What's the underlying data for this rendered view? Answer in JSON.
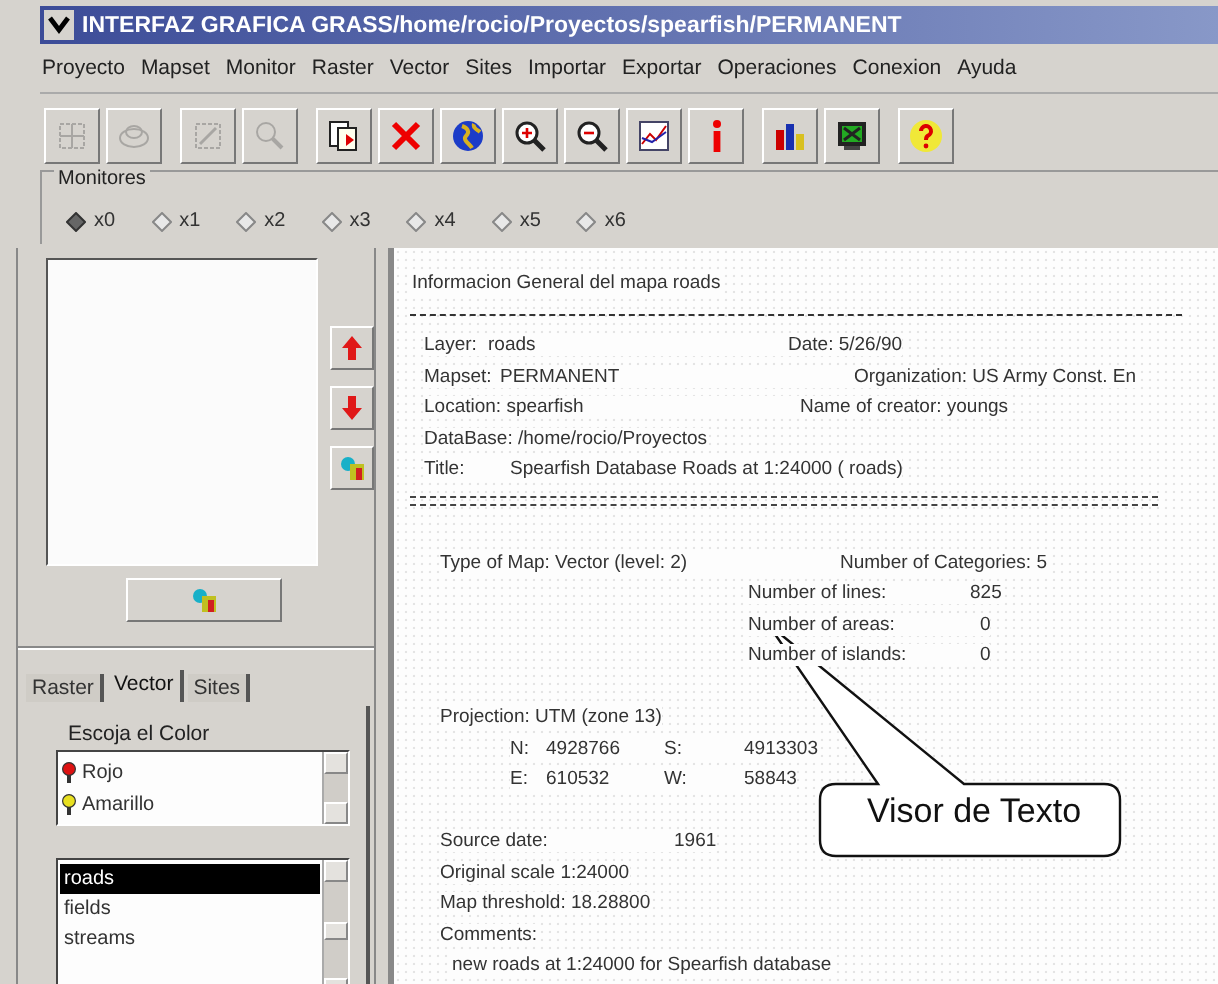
{
  "window": {
    "title": "INTERFAZ GRAFICA GRASS/home/rocio/Proyectos/spearfish/PERMANENT"
  },
  "menu": [
    "Proyecto",
    "Mapset",
    "Monitor",
    "Raster",
    "Vector",
    "Sites",
    "Importar",
    "Exportar",
    "Operaciones",
    "Conexion",
    "Ayuda"
  ],
  "toolbar": {
    "groups": [
      [
        {
          "disabled": true
        },
        {
          "disabled": true
        }
      ],
      [
        {
          "disabled": true
        },
        {
          "disabled": true
        }
      ],
      [
        {
          "disabled": false
        },
        {
          "disabled": false
        },
        {
          "disabled": false
        },
        {
          "disabled": false
        },
        {
          "disabled": false
        },
        {
          "disabled": false
        },
        {
          "disabled": false
        }
      ],
      [
        {
          "disabled": false
        },
        {
          "disabled": false
        }
      ],
      [
        {
          "disabled": false
        }
      ]
    ]
  },
  "monitors": {
    "label": "Monitores",
    "options": [
      {
        "label": "x0",
        "selected": true
      },
      {
        "label": "x1",
        "selected": false
      },
      {
        "label": "x2",
        "selected": false
      },
      {
        "label": "x3",
        "selected": false
      },
      {
        "label": "x4",
        "selected": false
      },
      {
        "label": "x5",
        "selected": false
      },
      {
        "label": "x6",
        "selected": false
      }
    ]
  },
  "layer_panel": {
    "tabs": [
      {
        "label": "Raster",
        "selected": false
      },
      {
        "label": "Vector",
        "selected": true
      },
      {
        "label": "Sites",
        "selected": false
      }
    ],
    "color_label": "Escoja el Color",
    "colors": [
      {
        "label": "Rojo",
        "color": "#dd1111"
      },
      {
        "label": "Amarillo",
        "color": "#e8e020"
      }
    ],
    "layers": [
      {
        "label": "roads",
        "selected": true
      },
      {
        "label": "fields",
        "selected": false
      },
      {
        "label": "streams",
        "selected": false
      }
    ]
  },
  "text_viewer": {
    "lines": [
      {
        "kind": "text",
        "cells": [
          "Informacion General del mapa roads"
        ]
      },
      {
        "kind": "dashed_rule"
      },
      {
        "kind": "text",
        "cells": [
          "Layer:",
          "roads",
          "Date: 5/26/90"
        ]
      },
      {
        "kind": "text",
        "cells": [
          "Mapset:",
          "PERMANENT",
          "Organization: US Army Const. En"
        ]
      },
      {
        "kind": "text",
        "cells": [
          "Location: spearfish",
          "Name of creator: youngs"
        ]
      },
      {
        "kind": "text",
        "cells": [
          "DataBase: /home/rocio/Proyectos"
        ]
      },
      {
        "kind": "text",
        "cells": [
          "Title:",
          "Spearfish Database Roads at 1:24000 ( roads)"
        ]
      },
      {
        "kind": "double_rule"
      },
      {
        "kind": "gap"
      },
      {
        "kind": "text",
        "cells": [
          "Type of Map:  Vector (level: 2)",
          "Number of Categories: 5"
        ]
      },
      {
        "kind": "text",
        "cells": [
          "Number of lines:",
          "825"
        ]
      },
      {
        "kind": "text",
        "cells": [
          "Number of areas:",
          "0"
        ]
      },
      {
        "kind": "text",
        "cells": [
          "Number of islands:",
          "0"
        ]
      },
      {
        "kind": "gap"
      },
      {
        "kind": "text",
        "cells": [
          "Projection: UTM (zone 13)"
        ]
      },
      {
        "kind": "text",
        "cells": [
          "N:",
          "4928766",
          "S:",
          "4913303"
        ]
      },
      {
        "kind": "text",
        "cells": [
          "E:",
          "610532",
          "W:",
          "58843"
        ]
      },
      {
        "kind": "gap"
      },
      {
        "kind": "text",
        "cells": [
          "Source date:",
          "1961"
        ]
      },
      {
        "kind": "text",
        "cells": [
          "Original scale 1:24000"
        ]
      },
      {
        "kind": "text",
        "cells": [
          "Map threshold: 18.28800"
        ]
      },
      {
        "kind": "text",
        "cells": [
          "Comments:"
        ]
      },
      {
        "kind": "text",
        "cells": [
          "new roads at 1:24000 for Spearfish database"
        ]
      }
    ]
  },
  "callout": {
    "text": "Visor de Texto"
  }
}
